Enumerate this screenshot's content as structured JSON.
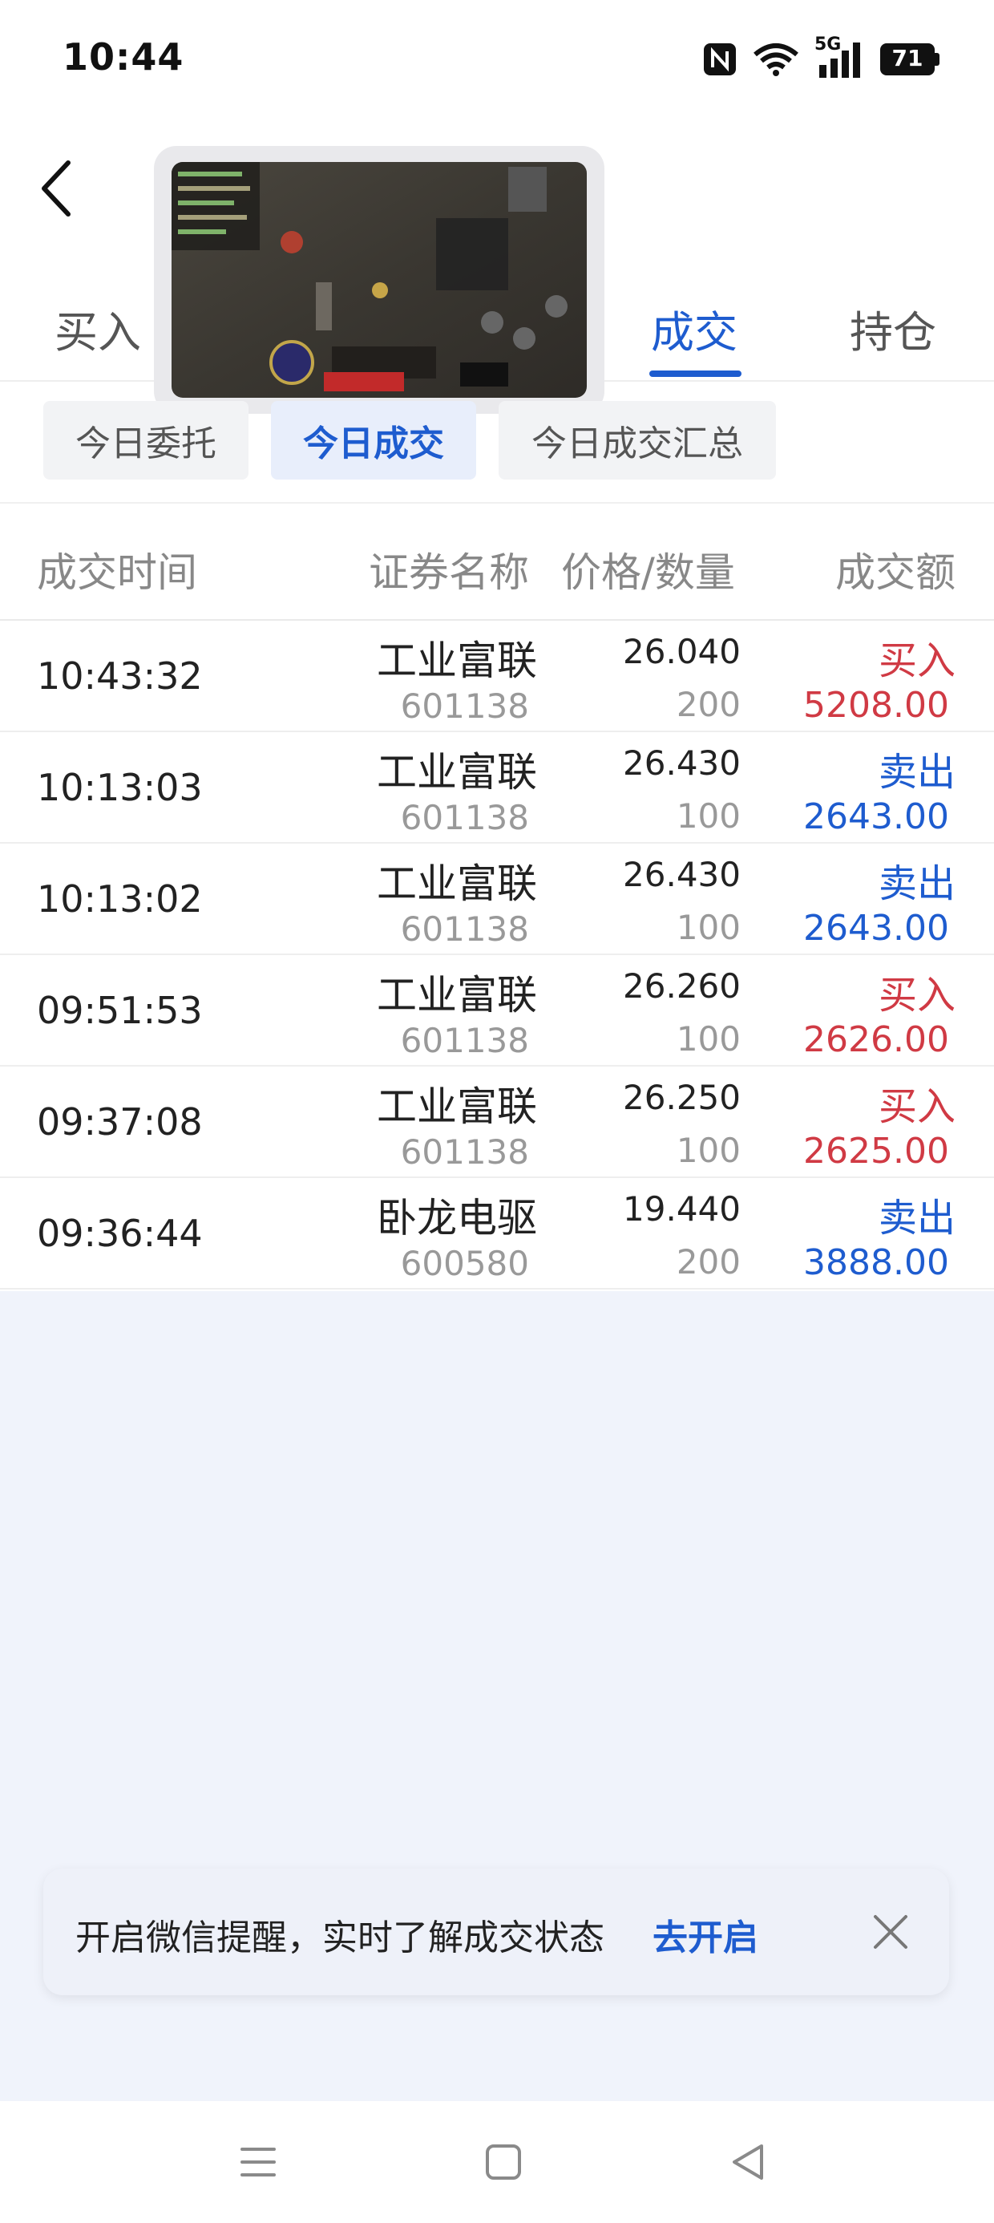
{
  "status_bar": {
    "time": "10:44",
    "network": "5G",
    "battery": "71"
  },
  "header": {
    "tabs": [
      {
        "label": "买入"
      },
      {
        "label": "成交"
      },
      {
        "label": "持仓"
      }
    ],
    "active_tab": "成交"
  },
  "sub_tabs": [
    {
      "label": "今日委托"
    },
    {
      "label": "今日成交"
    },
    {
      "label": "今日成交汇总"
    }
  ],
  "table": {
    "columns": [
      "成交时间",
      "证券名称",
      "价格/数量",
      "成交额"
    ],
    "rows": [
      {
        "time": "10:43:32",
        "name": "工业富联",
        "code": "601138",
        "price": "26.040",
        "qty": "200",
        "side": "买入",
        "amount": "5208.00"
      },
      {
        "time": "10:13:03",
        "name": "工业富联",
        "code": "601138",
        "price": "26.430",
        "qty": "100",
        "side": "卖出",
        "amount": "2643.00"
      },
      {
        "time": "10:13:02",
        "name": "工业富联",
        "code": "601138",
        "price": "26.430",
        "qty": "100",
        "side": "卖出",
        "amount": "2643.00"
      },
      {
        "time": "09:51:53",
        "name": "工业富联",
        "code": "601138",
        "price": "26.260",
        "qty": "100",
        "side": "买入",
        "amount": "2626.00"
      },
      {
        "time": "09:37:08",
        "name": "工业富联",
        "code": "601138",
        "price": "26.250",
        "qty": "100",
        "side": "买入",
        "amount": "2625.00"
      },
      {
        "time": "09:36:44",
        "name": "卧龙电驱",
        "code": "600580",
        "price": "19.440",
        "qty": "200",
        "side": "卖出",
        "amount": "3888.00"
      }
    ]
  },
  "banner": {
    "text": "开启微信提醒，实时了解成交状态",
    "link": "去开启"
  },
  "colors": {
    "accent": "#1e5ccf",
    "buy": "#d03a44",
    "sell": "#1e5ccf",
    "background": "#f0f3fb"
  }
}
